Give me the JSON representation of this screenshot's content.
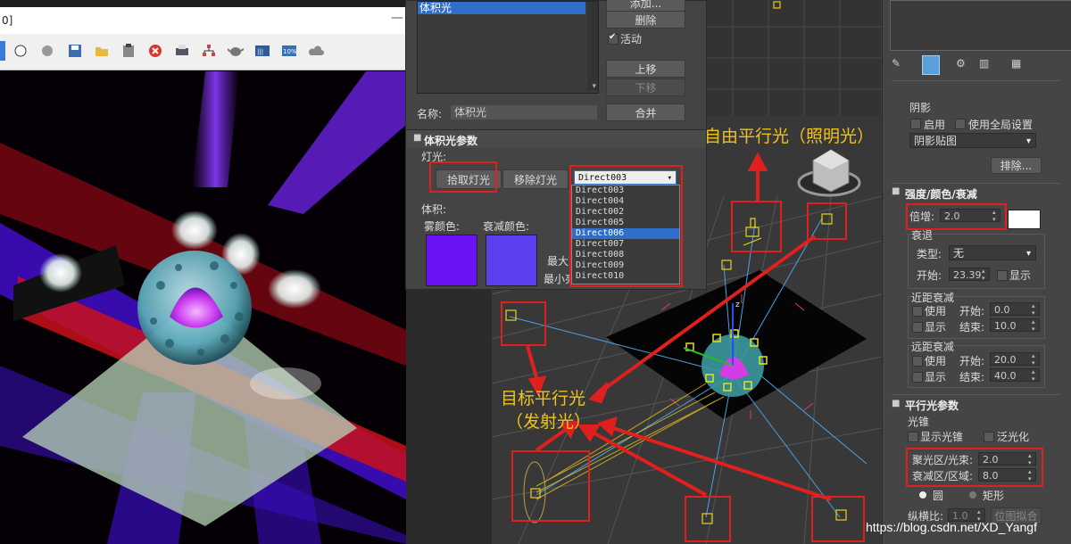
{
  "render_window": {
    "title_fragment": "0]",
    "title_buttons": {
      "minimize": "—"
    },
    "toolbar_icons": [
      "channel-icon",
      "white-dot-icon",
      "gray-dot-icon",
      "save-icon",
      "open-icon",
      "clipboard-icon",
      "clear-icon",
      "print-icon",
      "network-icon",
      "teapot-icon",
      "channels-icon",
      "histogram-icon",
      "cloud-icon"
    ]
  },
  "light_lister": {
    "list_items": [
      "体积光"
    ],
    "buttons": {
      "add": "添加...",
      "delete": "删除",
      "move_up": "上移",
      "move_down": "下移",
      "merge": "合并"
    },
    "active_label": "活动",
    "active_checked": true,
    "name_label": "名称:",
    "name_value": "体积光"
  },
  "volume_params": {
    "header": "体积光参数",
    "lights_label": "灯光:",
    "pick_light": "拾取灯光",
    "remove_light": "移除灯光",
    "selected_light": "Direct003",
    "light_options": [
      "Direct003",
      "Direct004",
      "Direct002",
      "Direct005",
      "Direct006",
      "Direct007",
      "Direct008",
      "Direct009",
      "Direct010"
    ],
    "selected_option_index": 4,
    "volume_label": "体积:",
    "fog_color_label": "雾颜色:",
    "atten_color_label": "衰减颜色:",
    "fog_color": "#6a12f2",
    "atten_color": "#5d3ff0",
    "max_label": "最大亮",
    "min_label": "最小亮"
  },
  "command_panel": {
    "tab_icons": [
      "pin-icon",
      "modifier-icon",
      "hierarchy-icon",
      "trash-icon",
      "configure-icon"
    ],
    "shadows": {
      "label": "阴影",
      "enable_label": "启用",
      "use_global_label": "使用全局设置",
      "shadow_type": "阴影贴图",
      "exclude_button": "排除..."
    },
    "intensity": {
      "header": "强度/颜色/衰减",
      "multiplier_label": "倍增:",
      "multiplier": "2.0",
      "color_swatch": "#ffffff",
      "decay_label": "衰退",
      "type_label": "类型:",
      "type_value": "无",
      "start_label": "开始:",
      "start_value": "23.39",
      "show_label": "显示",
      "near_label": "近距衰减",
      "use_label": "使用",
      "near_start": "0.0",
      "near_end": "10.0",
      "far_label": "远距衰减",
      "far_start": "20.0",
      "far_end": "40.0",
      "start_short": "开始:",
      "end_short": "结束:"
    },
    "directional": {
      "header": "平行光参数",
      "cone_label": "光锥",
      "show_cone": "显示光锥",
      "overshoot": "泛光化",
      "hotspot_label": "聚光区/光束:",
      "hotspot": "2.0",
      "falloff_label": "衰减区/区域:",
      "falloff": "8.0",
      "circle_label": "圆",
      "rect_label": "矩形",
      "aspect_label": "纵横比:",
      "aspect": "1.0",
      "bitmap_fit": "位图拟合"
    }
  },
  "annotations": {
    "free_direct": "自由平行光（照明光）",
    "target_direct_1": "目标平行光",
    "target_direct_2": "（发射光）"
  },
  "watermark": "https://blog.csdn.net/XD_Yangf"
}
